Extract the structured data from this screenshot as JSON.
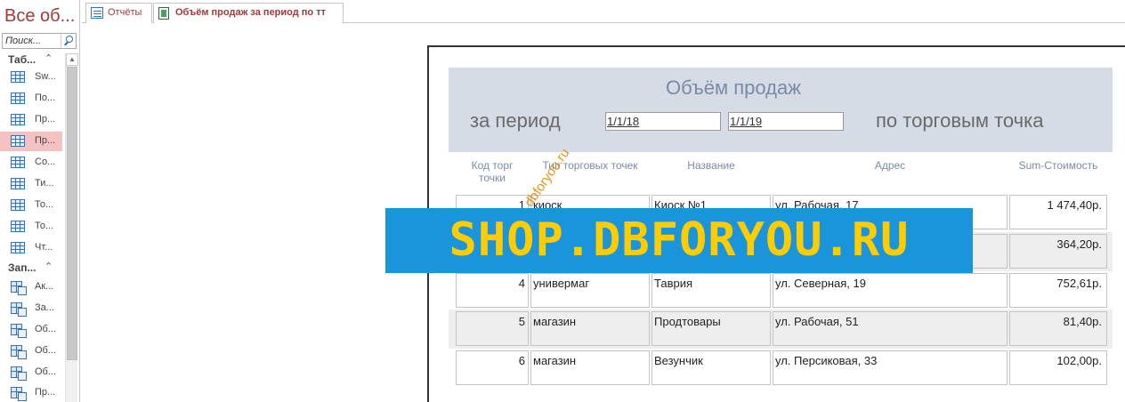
{
  "nav": {
    "title": "Все об...",
    "search_placeholder": "Поиск...",
    "groups": [
      {
        "label": "Таб...",
        "items": [
          {
            "label": "Sw...",
            "kind": "table",
            "selected": false
          },
          {
            "label": "По...",
            "kind": "table",
            "selected": false
          },
          {
            "label": "Пр...",
            "kind": "table",
            "selected": false
          },
          {
            "label": "Пр...",
            "kind": "table",
            "selected": true
          },
          {
            "label": "Со...",
            "kind": "table",
            "selected": false
          },
          {
            "label": "Ти...",
            "kind": "table",
            "selected": false
          },
          {
            "label": "То...",
            "kind": "table",
            "selected": false
          },
          {
            "label": "То...",
            "kind": "table",
            "selected": false
          },
          {
            "label": "Чт...",
            "kind": "table",
            "selected": false
          }
        ]
      },
      {
        "label": "Зап...",
        "items": [
          {
            "label": "Ак...",
            "kind": "query"
          },
          {
            "label": "За...",
            "kind": "query"
          },
          {
            "label": "Об...",
            "kind": "query"
          },
          {
            "label": "Об...",
            "kind": "query"
          },
          {
            "label": "Об...",
            "kind": "query"
          },
          {
            "label": "Пр...",
            "kind": "query"
          }
        ]
      }
    ]
  },
  "tabs": [
    {
      "label": "Отчёты",
      "icon": "form-icon",
      "active": false
    },
    {
      "label": "Объём продаж за период по тт",
      "icon": "report-icon",
      "active": true
    }
  ],
  "report": {
    "title": "Объём продаж",
    "period_label": "за период",
    "date_from": "1/1/18",
    "date_to": "1/1/19",
    "points_label": "по торговым точка",
    "columns": {
      "code": "Код торг точки",
      "type": "Тип торговых точек",
      "name": "Название",
      "address": "Адрес",
      "sum": "Sum-Стоимость"
    },
    "rows": [
      {
        "code": "1",
        "type": "киоск",
        "name": "Киоск №1",
        "address": "ул. Рабочая, 17",
        "sum": "1 474,40р."
      },
      {
        "code": "",
        "type": "",
        "name": "",
        "address": "",
        "sum": "364,20р."
      },
      {
        "code": "4",
        "type": "универмаг",
        "name": "Таврия",
        "address": "ул. Северная, 19",
        "sum": "752,61р."
      },
      {
        "code": "5",
        "type": "магазин",
        "name": "Продтовары",
        "address": "ул. Рабочая, 51",
        "sum": "81,40р."
      },
      {
        "code": "6",
        "type": "магазин",
        "name": "Везунчик",
        "address": "ул. Персиковая, 33",
        "sum": "102,00р."
      }
    ]
  },
  "watermark": {
    "banner": "SHOP.DBFORYOU.RU",
    "diagonal": "dbforyou.ru"
  },
  "colors": {
    "accent": "#a4373a",
    "header_band": "#d5dce6",
    "watermark_bg": "#1a95dc",
    "watermark_text": "#ffcc00"
  }
}
